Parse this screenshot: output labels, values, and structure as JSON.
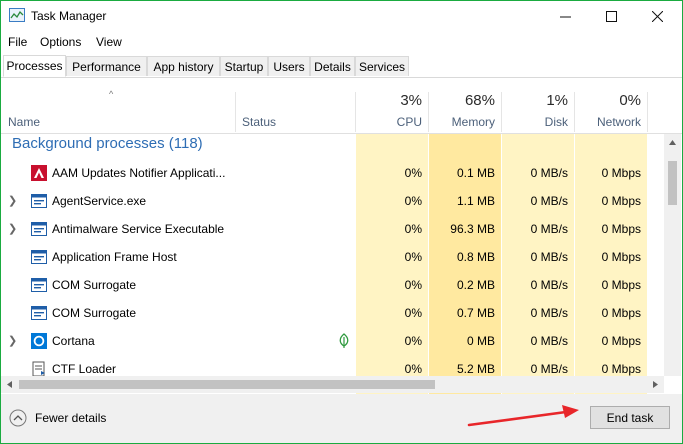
{
  "window": {
    "title": "Task Manager"
  },
  "menu": [
    "File",
    "Options",
    "View"
  ],
  "tabs": [
    "Processes",
    "Performance",
    "App history",
    "Startup",
    "Users",
    "Details",
    "Services"
  ],
  "active_tab": "Processes",
  "columns": {
    "name": "Name",
    "status": "Status",
    "cpu": {
      "pct": "3%",
      "label": "CPU"
    },
    "memory": {
      "pct": "68%",
      "label": "Memory"
    },
    "disk": {
      "pct": "1%",
      "label": "Disk"
    },
    "network": {
      "pct": "0%",
      "label": "Network"
    }
  },
  "group": {
    "title": "Background processes (118)"
  },
  "processes": [
    {
      "name": "AAM Updates Notifier Applicati...",
      "icon": "adobe-icon",
      "expandable": false,
      "status_icon": "",
      "cpu": "0%",
      "memory": "0.1 MB",
      "disk": "0 MB/s",
      "network": "0 Mbps"
    },
    {
      "name": "AgentService.exe",
      "icon": "window-app-icon",
      "expandable": true,
      "status_icon": "",
      "cpu": "0%",
      "memory": "1.1 MB",
      "disk": "0 MB/s",
      "network": "0 Mbps"
    },
    {
      "name": "Antimalware Service Executable",
      "icon": "window-app-icon",
      "expandable": true,
      "status_icon": "",
      "cpu": "0%",
      "memory": "96.3 MB",
      "disk": "0 MB/s",
      "network": "0 Mbps"
    },
    {
      "name": "Application Frame Host",
      "icon": "window-app-icon",
      "expandable": false,
      "status_icon": "",
      "cpu": "0%",
      "memory": "0.8 MB",
      "disk": "0 MB/s",
      "network": "0 Mbps"
    },
    {
      "name": "COM Surrogate",
      "icon": "window-app-icon",
      "expandable": false,
      "status_icon": "",
      "cpu": "0%",
      "memory": "0.2 MB",
      "disk": "0 MB/s",
      "network": "0 Mbps"
    },
    {
      "name": "COM Surrogate",
      "icon": "window-app-icon",
      "expandable": false,
      "status_icon": "",
      "cpu": "0%",
      "memory": "0.7 MB",
      "disk": "0 MB/s",
      "network": "0 Mbps"
    },
    {
      "name": "Cortana",
      "icon": "cortana-icon",
      "expandable": true,
      "status_icon": "leaf-icon",
      "cpu": "0%",
      "memory": "0 MB",
      "disk": "0 MB/s",
      "network": "0 Mbps"
    },
    {
      "name": "CTF Loader",
      "icon": "ctf-loader-icon",
      "expandable": false,
      "status_icon": "",
      "cpu": "0%",
      "memory": "5.2 MB",
      "disk": "0 MB/s",
      "network": "0 Mbps"
    }
  ],
  "footer": {
    "fewer_details": "Fewer details",
    "end_task": "End task"
  },
  "colors": {
    "accent_border": "#1aab40",
    "heat_light": "#fff4c4",
    "heat_dark": "#ffe9a0",
    "group_title": "#2e6db4",
    "annotation_arrow": "#e8262a"
  }
}
